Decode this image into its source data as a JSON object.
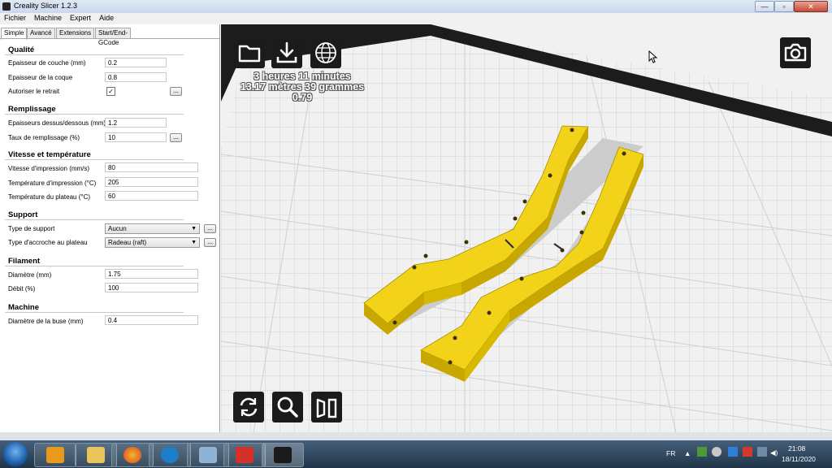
{
  "window": {
    "title": "Creality Slicer 1.2.3"
  },
  "menu": [
    "Fichier",
    "Machine",
    "Expert",
    "Aide"
  ],
  "tabs": [
    "Simple",
    "Avancé",
    "Extensions",
    "Start/End-GCode"
  ],
  "sections": {
    "quality": {
      "title": "Qualité",
      "layer_height_label": "Epaisseur de couche (mm)",
      "layer_height": "0.2",
      "shell_label": "Epaisseur de la coque",
      "shell": "0.8",
      "retraction_label": "Autoriser le retrait",
      "retraction_checked": true
    },
    "fill": {
      "title": "Remplissage",
      "topbottom_label": "Epaisseurs dessus/dessous (mm)",
      "topbottom": "1.2",
      "density_label": "Taux de remplissage (%)",
      "density": "10"
    },
    "speed": {
      "title": "Vitesse et température",
      "print_speed_label": "Vitesse d'impression (mm/s)",
      "print_speed": "80",
      "print_temp_label": "Température d'impression (°C)",
      "print_temp": "205",
      "bed_temp_label": "Température du plateau (°C)",
      "bed_temp": "60"
    },
    "support": {
      "title": "Support",
      "type_label": "Type de support",
      "type": "Aucun",
      "adhesion_label": "Type d'accroche au plateau",
      "adhesion": "Radeau (raft)"
    },
    "filament": {
      "title": "Filament",
      "diameter_label": "Diamètre (mm)",
      "diameter": "1.75",
      "flow_label": "Débit (%)",
      "flow": "100"
    },
    "machine": {
      "title": "Machine",
      "nozzle_label": "Diamètre de la buse (mm)",
      "nozzle": "0.4"
    }
  },
  "dots_label": "...",
  "viewport": {
    "print_time": "3 heures 11 minutes",
    "filament_used": "13.17 mètres 39 grammes",
    "cost": "0.79",
    "model_color": "#f3d21a",
    "bed_color": "#f1f1f1"
  },
  "taskbar": {
    "language": "FR",
    "time": "21:08",
    "date": "18/11/2020"
  }
}
